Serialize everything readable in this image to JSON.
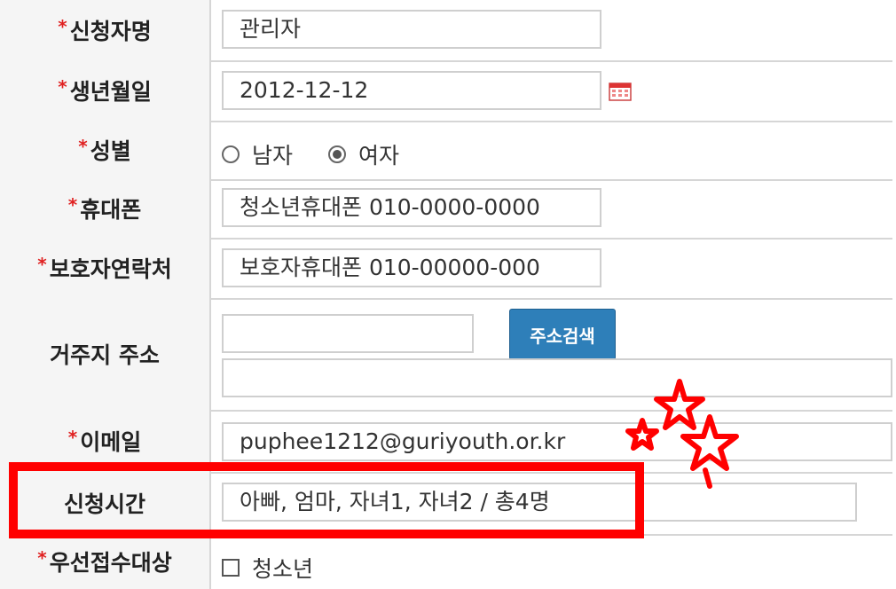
{
  "form": {
    "applicant_name": {
      "required_mark": "*",
      "label": "신청자명",
      "value": "관리자"
    },
    "birth_date": {
      "required_mark": "*",
      "label": "생년월일",
      "value": "2012-12-12",
      "icon": "calendar-icon"
    },
    "gender": {
      "required_mark": "*",
      "label": "성별",
      "options": [
        "남자",
        "여자"
      ],
      "selected": "여자"
    },
    "mobile": {
      "required_mark": "*",
      "label": "휴대폰",
      "value": "청소년휴대폰 010-0000-0000"
    },
    "guardian_contact": {
      "required_mark": "*",
      "label": "보호자연락처",
      "value": "보호자휴대폰 010-00000-000"
    },
    "address": {
      "label": "거주지 주소",
      "zip_value": "",
      "detail_value": "",
      "search_button": "주소검색"
    },
    "email": {
      "required_mark": "*",
      "label": "이메일",
      "value": "puphee1212@guriyouth.or.kr"
    },
    "apply_time": {
      "label": "신청시간",
      "value": "아빠, 엄마, 자녀1, 자녀2 / 총4명"
    },
    "priority": {
      "required_mark": "*",
      "label": "우선접수대상",
      "checkbox_label": "청소년",
      "checked": false
    }
  },
  "annotations": {
    "highlight_color": "#ff0000",
    "stars_color": "#ff0000"
  },
  "colors": {
    "button": "#2e7fb9",
    "label_bg": "#f5f5f5",
    "border": "#d6d6d6",
    "required": "#e02020"
  }
}
